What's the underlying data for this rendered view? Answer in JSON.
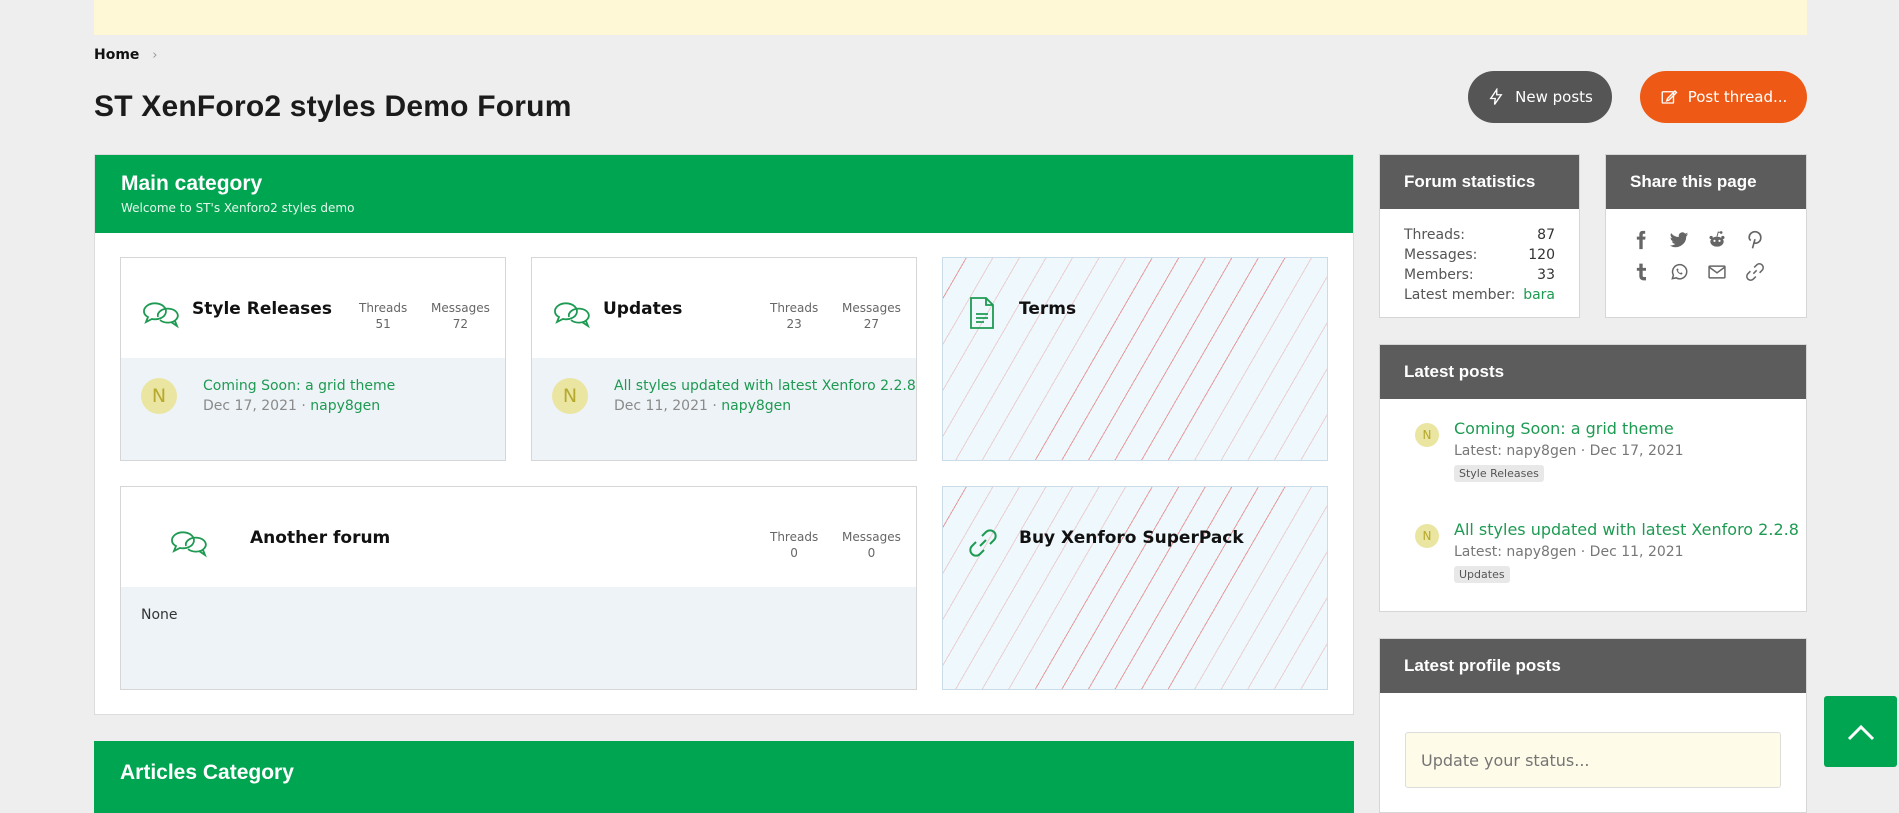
{
  "breadcrumb": {
    "home": "Home",
    "sep": "›"
  },
  "page": {
    "title": "ST XenForo2 styles Demo Forum"
  },
  "buttons": {
    "new_posts": "New posts",
    "post_thread": "Post thread..."
  },
  "main_category": {
    "title": "Main category",
    "description": "Welcome to ST's Xenforo2 styles demo",
    "nodes": [
      {
        "title": "Style Releases",
        "threads_label": "Threads",
        "threads": "51",
        "messages_label": "Messages",
        "messages": "72",
        "latest_title": "Coming Soon: a grid theme",
        "latest_date": "Dec 17, 2021",
        "latest_user": "napy8gen",
        "avatar": "N"
      },
      {
        "title": "Updates",
        "threads_label": "Threads",
        "threads": "23",
        "messages_label": "Messages",
        "messages": "27",
        "latest_title": "All styles updated with latest Xenforo 2.2.8",
        "latest_date": "Dec 11, 2021",
        "latest_user": "napy8gen",
        "avatar": "N"
      },
      {
        "title": "Another forum",
        "threads_label": "Threads",
        "threads": "0",
        "messages_label": "Messages",
        "messages": "0",
        "latest_none": "None"
      }
    ],
    "links": [
      {
        "title": "Terms"
      },
      {
        "title": "Buy Xenforo SuperPack"
      }
    ]
  },
  "articles_category": {
    "title": "Articles Category"
  },
  "sidebar": {
    "forum_statistics": {
      "title": "Forum statistics",
      "rows": [
        {
          "label": "Threads:",
          "value": "87"
        },
        {
          "label": "Messages:",
          "value": "120"
        },
        {
          "label": "Members:",
          "value": "33"
        },
        {
          "label": "Latest member:",
          "value": "bara"
        }
      ]
    },
    "share": {
      "title": "Share this page",
      "icons": [
        "facebook-icon",
        "twitter-icon",
        "reddit-icon",
        "pinterest-icon",
        "tumblr-icon",
        "whatsapp-icon",
        "email-icon",
        "link-icon"
      ]
    },
    "latest_posts": {
      "title": "Latest posts",
      "items": [
        {
          "title": "Coming Soon: a grid theme",
          "meta": "Latest: napy8gen · Dec 17, 2021",
          "forum": "Style Releases",
          "avatar": "N"
        },
        {
          "title": "All styles updated with latest Xenforo 2.2.8",
          "meta": "Latest: napy8gen · Dec 11, 2021",
          "forum": "Updates",
          "avatar": "N"
        }
      ]
    },
    "latest_profile_posts": {
      "title": "Latest profile posts",
      "placeholder": "Update your status..."
    }
  },
  "colors": {
    "accent": "#00a551",
    "orange": "#ee5a15",
    "dark": "#5c5c5c",
    "link": "#1e9a52"
  }
}
